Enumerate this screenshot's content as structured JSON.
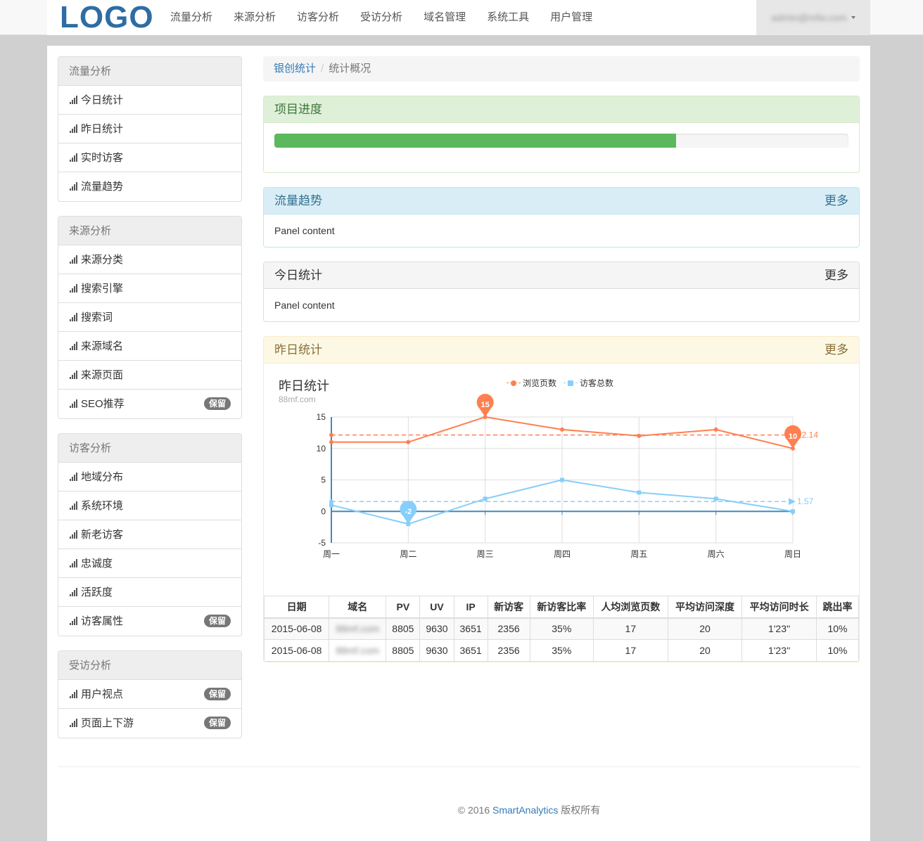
{
  "navbar": {
    "logo": "LOGO",
    "items": [
      "流量分析",
      "来源分析",
      "访客分析",
      "受访分析",
      "域名管理",
      "系统工具",
      "用户管理"
    ],
    "user_email": "admin@mfw.com"
  },
  "sidebar": {
    "groups": [
      {
        "heading": "流量分析",
        "items": [
          {
            "label": "今日统计"
          },
          {
            "label": "昨日统计"
          },
          {
            "label": "实时访客"
          },
          {
            "label": "流量趋势"
          }
        ]
      },
      {
        "heading": "来源分析",
        "items": [
          {
            "label": "来源分类"
          },
          {
            "label": "搜索引擎"
          },
          {
            "label": "搜索词"
          },
          {
            "label": "来源域名"
          },
          {
            "label": "来源页面"
          },
          {
            "label": "SEO推荐",
            "badge": "保留"
          }
        ]
      },
      {
        "heading": "访客分析",
        "items": [
          {
            "label": "地域分布"
          },
          {
            "label": "系统环境"
          },
          {
            "label": "新老访客"
          },
          {
            "label": "忠诚度"
          },
          {
            "label": "活跃度"
          },
          {
            "label": "访客属性",
            "badge": "保留"
          }
        ]
      },
      {
        "heading": "受访分析",
        "items": [
          {
            "label": "用户视点",
            "badge": "保留"
          },
          {
            "label": "页面上下游",
            "badge": "保留"
          }
        ]
      }
    ]
  },
  "breadcrumb": {
    "link": "银创统计",
    "active": "统计概况"
  },
  "panels": {
    "progress": {
      "title": "项目进度",
      "value": 0.7
    },
    "trend": {
      "title": "流量趋势",
      "more": "更多",
      "content": "Panel content"
    },
    "today": {
      "title": "今日统计",
      "more": "更多",
      "content": "Panel content"
    },
    "yesterday": {
      "title": "昨日统计",
      "more": "更多"
    }
  },
  "chart_data": {
    "type": "line",
    "title": "昨日统计",
    "subtitle": "88mf.com",
    "categories": [
      "周一",
      "周二",
      "周三",
      "周四",
      "周五",
      "周六",
      "周日"
    ],
    "ylim": [
      -5,
      15
    ],
    "yticks": [
      15,
      10,
      5,
      0,
      -5
    ],
    "grid": true,
    "legend_position": "top",
    "series": [
      {
        "name": "浏览页数",
        "values": [
          11,
          11,
          15,
          13,
          12,
          13,
          10
        ],
        "color": "#ff7f50",
        "max_label": "15",
        "min_label": "10",
        "average": 12.14,
        "average_label": "12.14"
      },
      {
        "name": "访客总数",
        "values": [
          1,
          -2,
          2,
          5,
          3,
          2,
          0
        ],
        "color": "#87cefa",
        "min_label": "-2",
        "average": 1.57,
        "average_label": "1.57"
      }
    ]
  },
  "table": {
    "headers": [
      "日期",
      "域名",
      "PV",
      "UV",
      "IP",
      "新访客",
      "新访客比率",
      "人均浏览页数",
      "平均访问深度",
      "平均访问时长",
      "跳出率"
    ],
    "rows": [
      [
        "2015-06-08",
        "88mf.com",
        "8805",
        "9630",
        "3651",
        "2356",
        "35%",
        "17",
        "20",
        "1'23''",
        "10%"
      ],
      [
        "2015-06-08",
        "88mf.com",
        "8805",
        "9630",
        "3651",
        "2356",
        "35%",
        "17",
        "20",
        "1'23''",
        "10%"
      ]
    ]
  },
  "footer": {
    "prefix": "© 2016",
    "brand": "SmartAnalytics",
    "suffix": "版权所有"
  }
}
